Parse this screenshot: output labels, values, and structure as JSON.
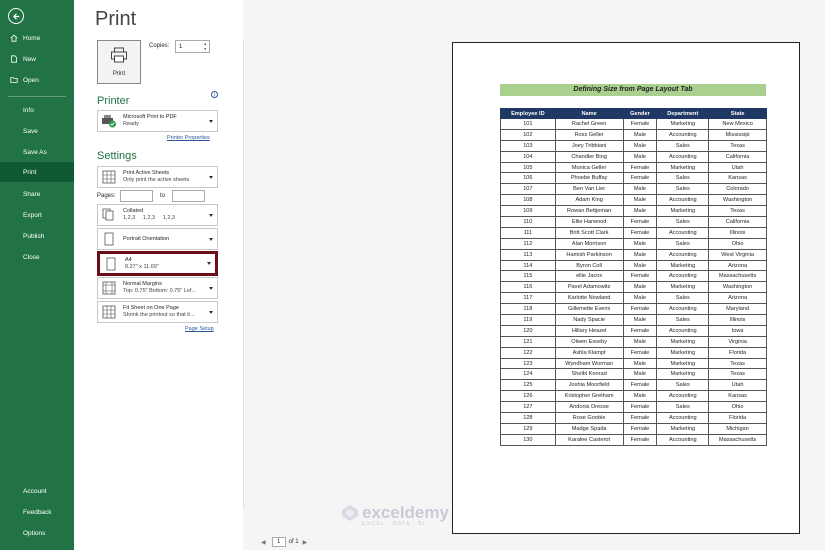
{
  "sidebar": {
    "items_top": [
      {
        "label": "Home"
      },
      {
        "label": "New"
      },
      {
        "label": "Open"
      }
    ],
    "items_mid": [
      {
        "label": "Info"
      },
      {
        "label": "Save"
      },
      {
        "label": "Save As"
      },
      {
        "label": "Print"
      },
      {
        "label": "Share"
      },
      {
        "label": "Export"
      },
      {
        "label": "Publish"
      },
      {
        "label": "Close"
      }
    ],
    "items_bottom": [
      {
        "label": "Account"
      },
      {
        "label": "Feedback"
      },
      {
        "label": "Options"
      }
    ],
    "active": "Print"
  },
  "page_title": "Print",
  "print_button": {
    "label": "Print"
  },
  "copies": {
    "label": "Copies:",
    "value": "1"
  },
  "printer": {
    "heading": "Printer",
    "name": "Microsoft Print to PDF",
    "status": "Ready",
    "properties_link": "Printer Properties"
  },
  "settings": {
    "heading": "Settings",
    "what": {
      "title": "Print Active Sheets",
      "sub": "Only print the active sheets"
    },
    "pages_label": "Pages:",
    "to_label": "to",
    "collation": {
      "title": "Collated",
      "sub": "1,2,3     1,2,3     1,2,3"
    },
    "orientation": {
      "title": "Portrait Orientation"
    },
    "paper": {
      "title": "A4",
      "sub": "8.27\" x 11.69\""
    },
    "margins": {
      "title": "Normal Margins",
      "sub": "Top: 0.75\" Bottom: 0.75\" Lef..."
    },
    "scaling": {
      "title": "Fit Sheet on One Page",
      "sub": "Shrink the printout so that it..."
    },
    "page_setup_link": "Page Setup"
  },
  "preview": {
    "sheet_title": "Defining Size from Page Layout Tab",
    "columns": [
      "Employee ID",
      "Name",
      "Gender",
      "Department",
      "State"
    ],
    "rows": [
      [
        "101",
        "Rachel Green",
        "Female",
        "Marketing",
        "New Mexico"
      ],
      [
        "102",
        "Ross Geller",
        "Male",
        "Accounting",
        "Mississipi"
      ],
      [
        "103",
        "Joey Tribbiani",
        "Male",
        "Sales",
        "Texas"
      ],
      [
        "104",
        "Chandler Bing",
        "Male",
        "Accounting",
        "California"
      ],
      [
        "105",
        "Monica Geller",
        "Female",
        "Marketing",
        "Utah"
      ],
      [
        "106",
        "Phoebe Buffay",
        "Female",
        "Sales",
        "Kansas"
      ],
      [
        "107",
        "Ben Van Lier",
        "Male",
        "Sales",
        "Colorado"
      ],
      [
        "108",
        "Adam King",
        "Male",
        "Accounting",
        "Washington"
      ],
      [
        "109",
        "Rowan Bettjeman",
        "Male",
        "Marketing",
        "Texas"
      ],
      [
        "110",
        "Ellie Harwood",
        "Female",
        "Sales",
        "California"
      ],
      [
        "111",
        "Britt Scott Clark",
        "Female",
        "Accounting",
        "Illinois"
      ],
      [
        "112",
        "Alan Morrison",
        "Male",
        "Sales",
        "Ohio"
      ],
      [
        "113",
        "Hamish Parkinson",
        "Male",
        "Accounting",
        "West Virginia"
      ],
      [
        "114",
        "Byron Coll",
        "Male",
        "Marketing",
        "Arizona"
      ],
      [
        "115",
        "ellie Jacox",
        "Female",
        "Accounting",
        "Massachusetts"
      ],
      [
        "116",
        "Pavel Adamowitz",
        "Male",
        "Marketing",
        "Washington"
      ],
      [
        "117",
        "Karlotte Nowland",
        "Male",
        "Sales",
        "Arizona"
      ],
      [
        "118",
        "Gillemette Everix",
        "Female",
        "Accounting",
        "Maryland"
      ],
      [
        "119",
        "Nady Spacie",
        "Male",
        "Sales",
        "Illinois"
      ],
      [
        "120",
        "Hillary Heazel",
        "Female",
        "Accounting",
        "Iowa"
      ],
      [
        "121",
        "Olwen Esseby",
        "Male",
        "Marketing",
        "Virginia"
      ],
      [
        "122",
        "Ashla Klampt",
        "Female",
        "Marketing",
        "Florida"
      ],
      [
        "123",
        "Wyndham Worman",
        "Male",
        "Marketing",
        "Texas"
      ],
      [
        "124",
        "Shelbi Konrad",
        "Male",
        "Marketing",
        "Texas"
      ],
      [
        "125",
        "Joshia Moorfield",
        "Female",
        "Sales",
        "Utah"
      ],
      [
        "126",
        "Kristopher Gretham",
        "Male",
        "Accounting",
        "Kansas"
      ],
      [
        "127",
        "Andonis Dresse",
        "Female",
        "Sales",
        "Ohio"
      ],
      [
        "128",
        "Rose Gooble",
        "Female",
        "Accounting",
        "Florida"
      ],
      [
        "129",
        "Madge Spada",
        "Female",
        "Marketing",
        "Michigan"
      ],
      [
        "130",
        "Karalee Casterot",
        "Female",
        "Accounting",
        "Massachusetts"
      ]
    ]
  },
  "pager": {
    "current": "1",
    "of_text": "of 1"
  },
  "watermark": {
    "main": "exceldemy",
    "sub": "EXCEL · DATA · BI"
  },
  "colors": {
    "sidebar": "#217346",
    "active": "#0f5a32",
    "header": "#203864",
    "title_bg": "#a9d08e",
    "highlight": "#6e0d1a"
  }
}
